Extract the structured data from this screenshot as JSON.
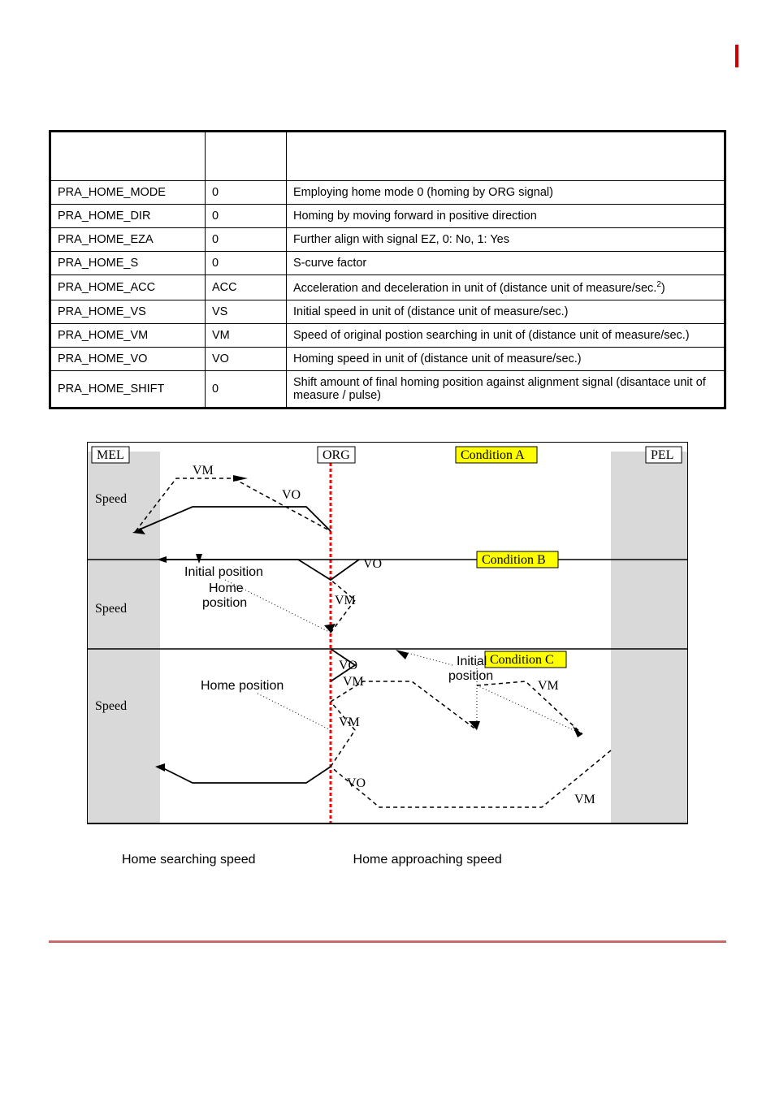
{
  "table": {
    "headers": [
      "",
      "",
      ""
    ],
    "rows": [
      {
        "param": "PRA_HOME_MODE",
        "value": "0",
        "desc": "Employing home mode 0 (homing by ORG signal)"
      },
      {
        "param": "PRA_HOME_DIR",
        "value": "0",
        "desc": "Homing by moving forward in positive direction"
      },
      {
        "param": "PRA_HOME_EZA",
        "value": "0",
        "desc": "Further align with signal EZ, 0: No, 1: Yes"
      },
      {
        "param": "PRA_HOME_S",
        "value": "0",
        "desc": "S-curve factor"
      },
      {
        "param": "PRA_HOME_ACC",
        "value": "ACC",
        "desc": "Acceleration and deceleration in unit of (distance unit of measure/sec.",
        "sup": "2",
        "desc_tail": ")"
      },
      {
        "param": "PRA_HOME_VS",
        "value": "VS",
        "desc": "Initial speed in unit of (distance unit of measure/sec.)"
      },
      {
        "param": "PRA_HOME_VM",
        "value": "VM",
        "desc": "Speed of original postion searching in unit of (distance unit of measure/sec.)"
      },
      {
        "param": "PRA_HOME_VO",
        "value": "VO",
        "desc": "Homing speed in unit of (distance unit of measure/sec.)"
      },
      {
        "param": "PRA_HOME_SHIFT",
        "value": "0",
        "desc": "Shift amount of final homing position against alignment signal (disantace unit of measure / pulse)"
      }
    ]
  },
  "diagram": {
    "mel": "MEL",
    "org": "ORG",
    "pel": "PEL",
    "condA": "Condition A",
    "condB": "Condition B",
    "condC": "Condition C",
    "speed": "Speed",
    "vm": "VM",
    "vo": "VO",
    "initial_position": "Initial position",
    "initial": "Initial",
    "position": "position",
    "home": "Home",
    "home_position": "Home position",
    "legend_search": "Home searching speed",
    "legend_approach": "Home approaching speed"
  }
}
